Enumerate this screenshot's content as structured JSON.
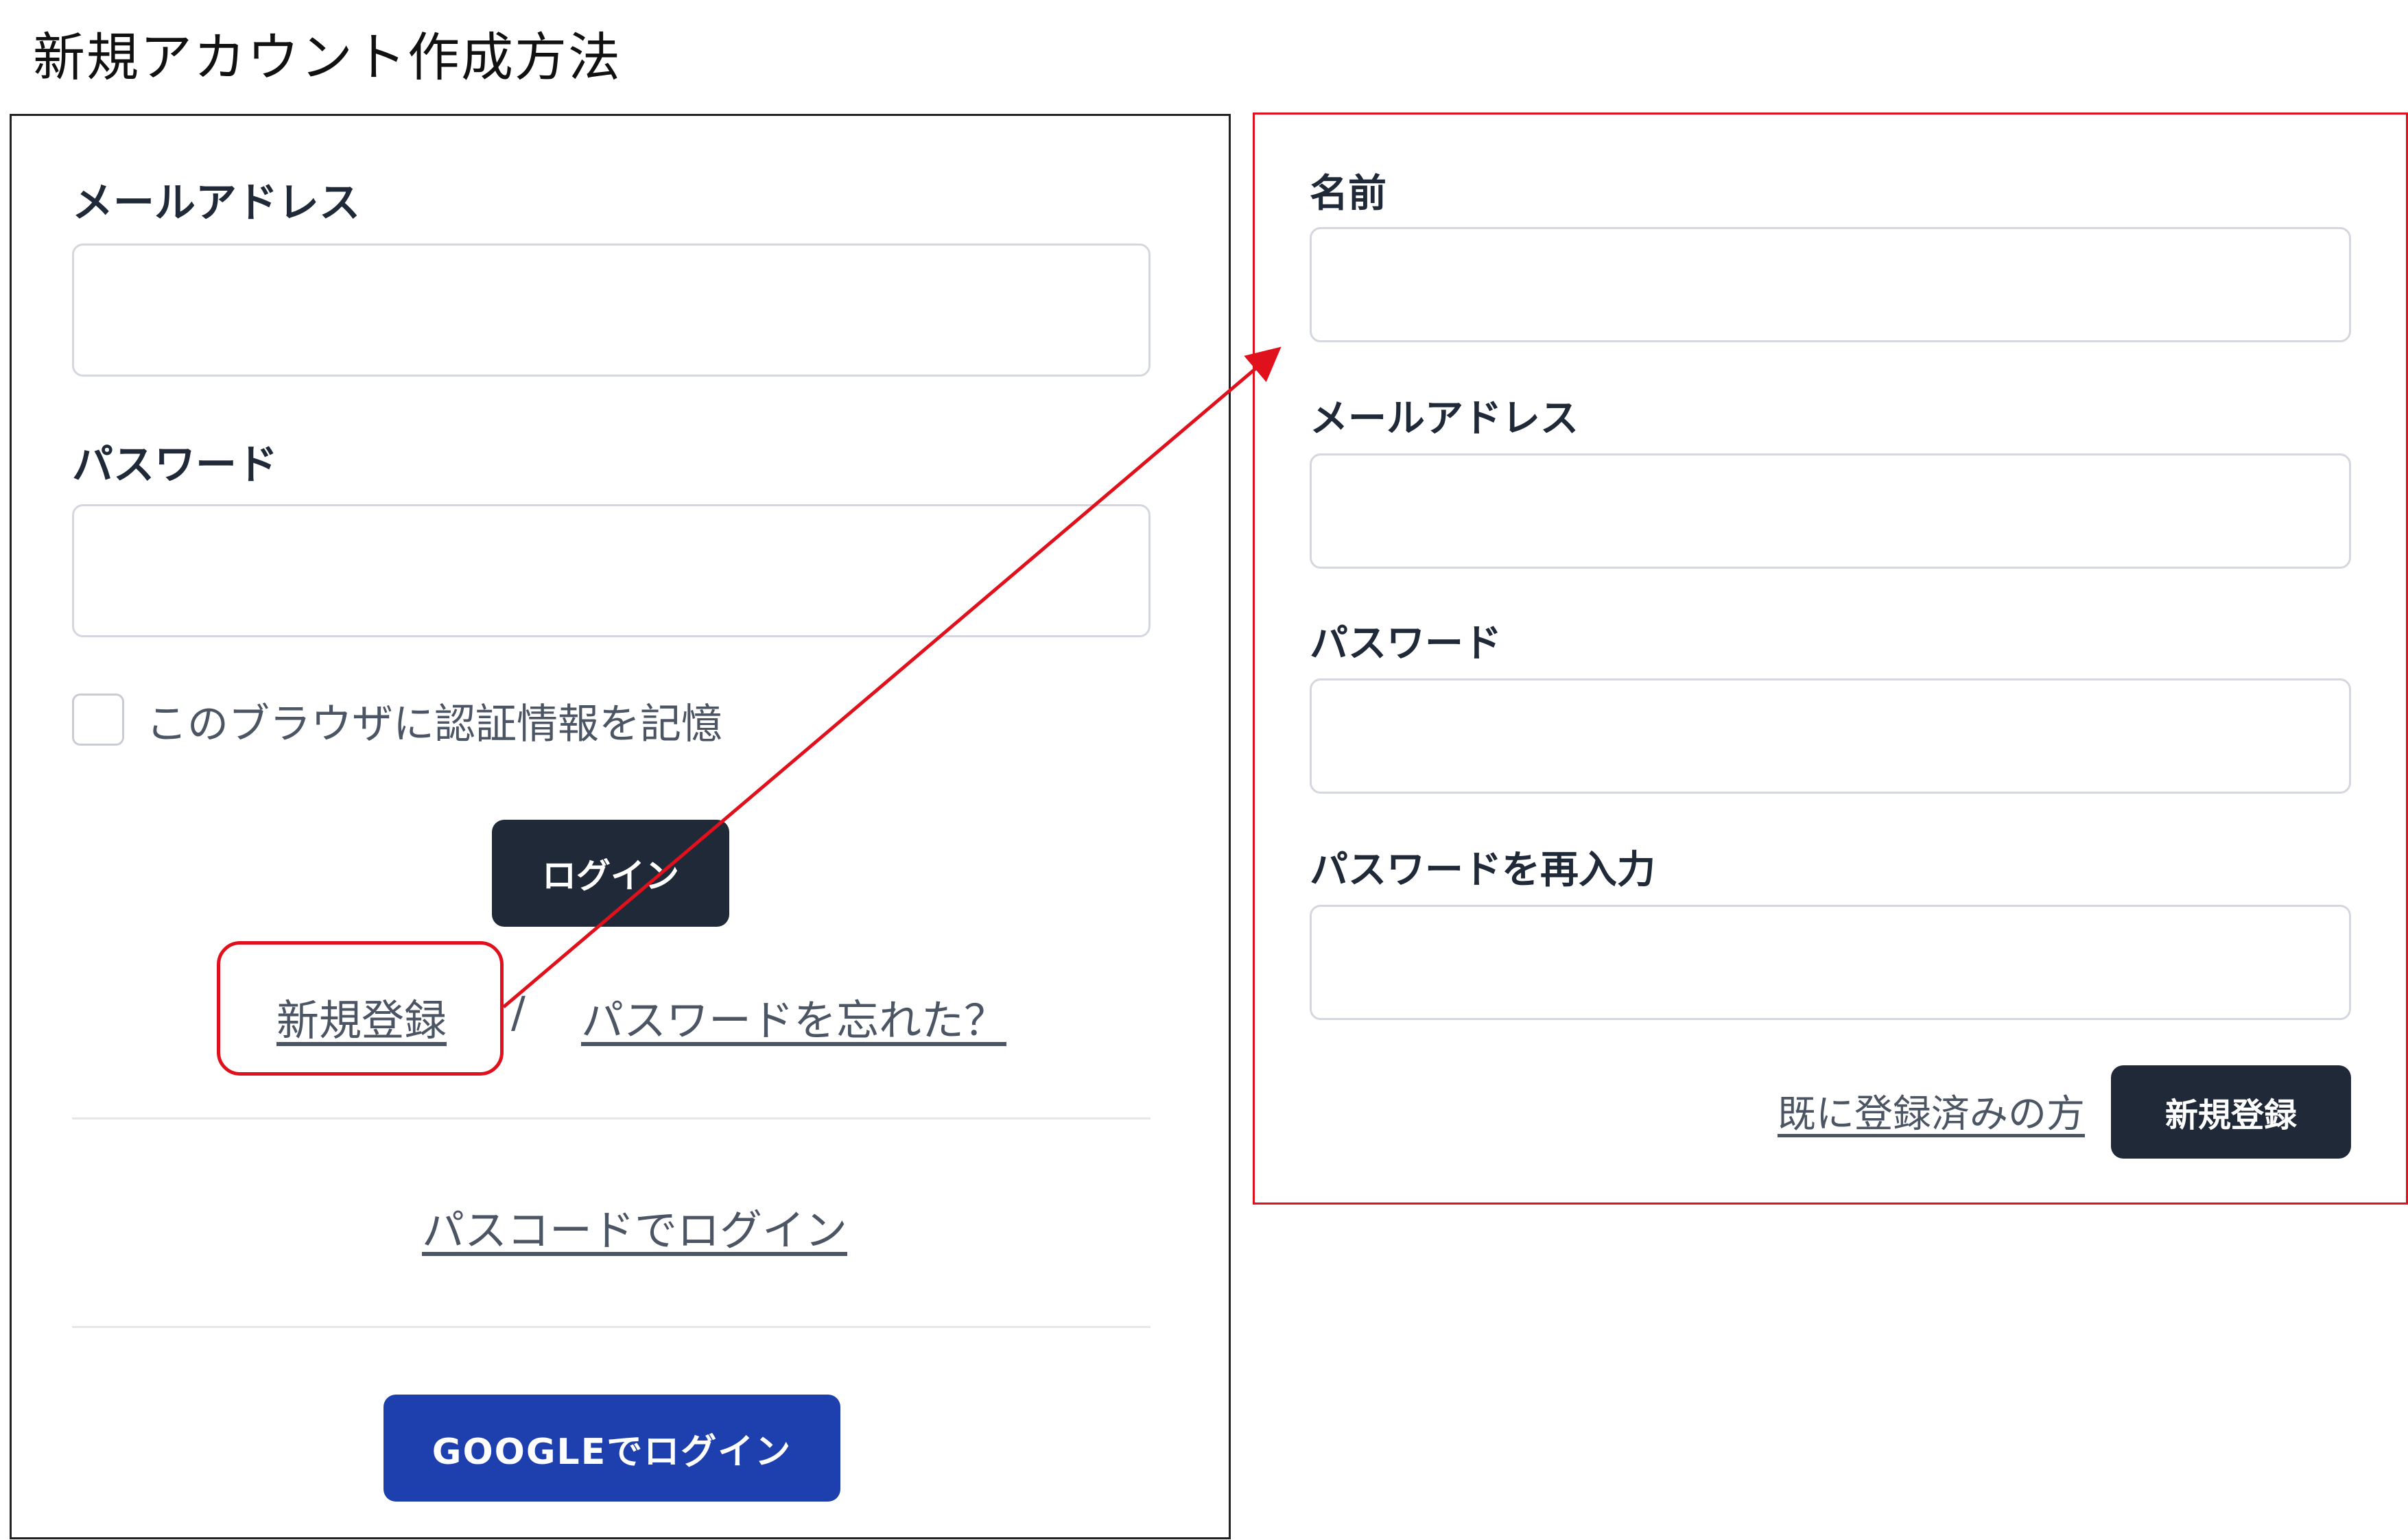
{
  "page": {
    "title": "新規アカウント作成方法"
  },
  "login": {
    "email_label": "メールアドレス",
    "password_label": "パスワード",
    "remember_label": "このブラウザに認証情報を記憶",
    "login_button": "ログイン",
    "register_link": "新規登録",
    "separator": "/",
    "forgot_link": "パスワードを忘れた？",
    "passcode_link": "パスコードでログイン",
    "google_button": "GOOGLEでログイン"
  },
  "signup": {
    "name_label": "名前",
    "email_label": "メールアドレス",
    "password_label": "パスワード",
    "confirm_label": "パスワードを再入力",
    "already_link": "既に登録済みの方",
    "register_button": "新規登録"
  },
  "colors": {
    "annotation_red": "#e0101c",
    "dark_button": "#1f2937",
    "google_button": "#1e40af"
  }
}
